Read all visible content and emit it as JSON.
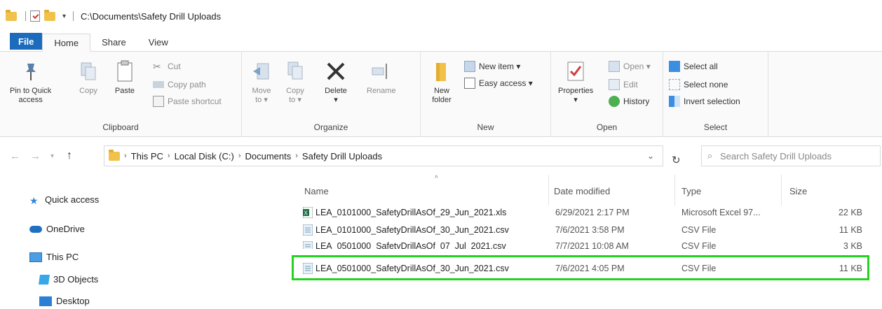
{
  "window": {
    "title": "C:\\Documents\\Safety Drill Uploads"
  },
  "tabs": [
    "File",
    "Home",
    "Share",
    "View"
  ],
  "ribbon": {
    "clipboard": {
      "pin_label_1": "Pin to Quick",
      "pin_label_2": "access",
      "copy": "Copy",
      "paste": "Paste",
      "cut": "Cut",
      "copy_path": "Copy path",
      "paste_shortcut": "Paste shortcut",
      "group": "Clipboard"
    },
    "organize": {
      "move_1": "Move",
      "move_2": "to ▾",
      "copy_1": "Copy",
      "copy_2": "to ▾",
      "delete": "Delete",
      "delete_arrow": "▾",
      "rename": "Rename",
      "group": "Organize"
    },
    "new": {
      "new_folder_1": "New",
      "new_folder_2": "folder",
      "new_item": "New item ▾",
      "easy_access": "Easy access ▾",
      "group": "New"
    },
    "open": {
      "properties": "Properties",
      "properties_arrow": "▾",
      "open": "Open ▾",
      "edit": "Edit",
      "history": "History",
      "group": "Open"
    },
    "select": {
      "select_all": "Select all",
      "select_none": "Select none",
      "invert": "Invert selection",
      "group": "Select"
    }
  },
  "address": {
    "crumbs": [
      "This PC",
      "Local Disk (C:)",
      "Documents",
      "Safety Drill Uploads"
    ],
    "search_placeholder": "Search Safety Drill Uploads"
  },
  "nav_pane": {
    "quick_access": "Quick access",
    "onedrive": "OneDrive",
    "this_pc": "This PC",
    "objects_3d": "3D Objects",
    "desktop": "Desktop"
  },
  "columns": {
    "name": "Name",
    "date": "Date modified",
    "type": "Type",
    "size": "Size"
  },
  "files": [
    {
      "name": "LEA_0101000_SafetyDrillAsOf_29_Jun_2021.xls",
      "date": "6/29/2021 2:17 PM",
      "type": "Microsoft Excel 97...",
      "size": "22 KB",
      "icon": "excel-file-icon"
    },
    {
      "name": "LEA_0101000_SafetyDrillAsOf_30_Jun_2021.csv",
      "date": "7/6/2021 3:58 PM",
      "type": "CSV File",
      "size": "11 KB",
      "icon": "csv-file-icon"
    },
    {
      "name": "LEA_0501000_SafetyDrillAsOf_07_Jul_2021.csv",
      "date": "7/7/2021 10:08 AM",
      "type": "CSV File",
      "size": "3 KB",
      "icon": "csv-file-icon"
    },
    {
      "name": "LEA_0501000_SafetyDrillAsOf_30_Jun_2021.csv",
      "date": "7/6/2021 4:05 PM",
      "type": "CSV File",
      "size": "11 KB",
      "icon": "csv-file-icon"
    }
  ],
  "colors": {
    "file_tab": "#1d6bbd",
    "highlight": "#22d41f",
    "folder": "#f0c24a"
  }
}
